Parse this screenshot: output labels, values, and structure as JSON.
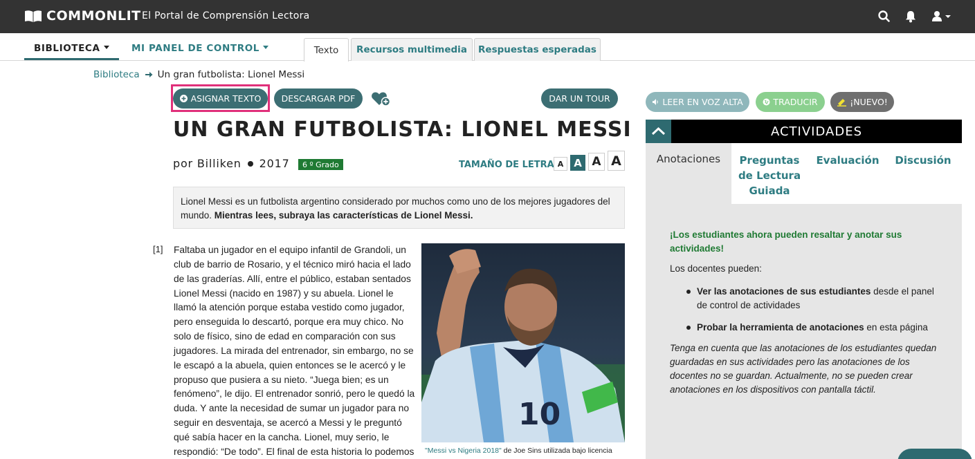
{
  "app": {
    "brand": "COMMONLIT",
    "portal": "El Portal de Comprensión Lectora"
  },
  "nav": {
    "library": "BIBLIOTECA",
    "dashboard": "MI PANEL DE CONTROL",
    "tabs": [
      {
        "label": "Texto",
        "active": true
      },
      {
        "label": "Recursos multimedia",
        "active": false
      },
      {
        "label": "Respuestas esperadas",
        "active": false
      }
    ]
  },
  "breadcrumb": {
    "root": "Biblioteca",
    "current": "Un gran futbolista: Lionel Messi"
  },
  "actions": {
    "assign": "ASIGNAR TEXTO",
    "download": "DESCARGAR PDF",
    "tour": "DAR UN TOUR"
  },
  "text": {
    "title": "UN GRAN FUTBOLISTA: LIONEL MESSI",
    "author_prefix": "por",
    "author": "Billiken",
    "year": "2017",
    "grade": "6 º Grado",
    "font_size_label": "TAMAÑO DE LETRA",
    "font_sizes": [
      "A",
      "A",
      "A",
      "A"
    ],
    "intro": "Lionel Messi es un futbolista argentino considerado por muchos como uno de los mejores jugadores del mundo.",
    "intro_bold": "Mientras lees, subraya las características de Lionel Messi.",
    "paragraph_number": "[1]",
    "paragraph": "Faltaba un jugador en el equipo infantil de Grandoli, un club de barrio de Rosario, y el técnico miró hacia el lado de las graderías. Allí, entre el público, estaban sentados Lionel Messi (nacido en 1987) y su abuela. Lionel le llamó la atención porque estaba vestido como jugador, pero enseguida lo descartó, porque era muy chico. No solo de físico, sino de edad en comparación con sus jugadores. La mirada del entrenador, sin embargo, no se le escapó a la abuela, quien entonces se le acercó y le propuso que pusiera a su nieto. “Juega bien; es un fenómeno”, le dijo. El entrenador sonrió, pero le quedó la duda. Y ante la necesidad de sumar un jugador para no seguir en desventaja, se acercó a Messi y le preguntó qué sabía hacer en la cancha. Lionel, muy serio, le respondió: “De todo”. El final de esta historia lo podemos imaginar. Messi",
    "caption_link": "\"Messi vs Nigeria 2018\"",
    "caption_rest": " de Joe Sins utilizada bajo licencia"
  },
  "tools": {
    "read_aloud": "LEER EN VOZ ALTA",
    "translate": "TRADUCIR",
    "new": "¡NUEVO!"
  },
  "activities": {
    "title": "ACTIVIDADES",
    "tabs": [
      "Anotaciones",
      "Preguntas de Lectura Guiada",
      "Evaluación",
      "Discusión"
    ],
    "headline": "¡Los estudiantes ahora pueden resaltar y anotar sus actividades!",
    "lead": "Los docentes pueden:",
    "items": [
      {
        "bold": "Ver las anotaciones de sus estudiantes",
        "rest": " desde el panel de control de actividades"
      },
      {
        "bold": "Probar la herramienta de anotaciones",
        "rest": " en esta página"
      }
    ],
    "note": "Tenga en cuenta que las anotaciones de los estudiantes quedan guardadas en sus actividades pero las anotaciones de los docentes no se guardan. Actualmente, no se pueden crear anotaciones en los dispositivos con pantalla táctil."
  },
  "colors": {
    "topbar": "#333333",
    "teal": "#2e7c82",
    "button": "#3c6e73",
    "grade_green": "#1f7a33",
    "highlight": "#e0307a"
  }
}
